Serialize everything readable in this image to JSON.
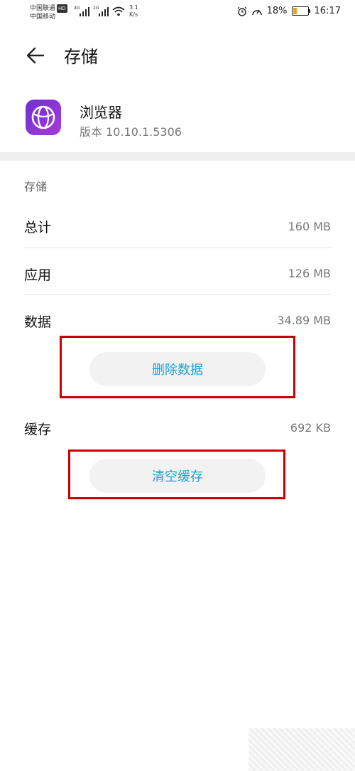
{
  "status_bar": {
    "carrier1": "中国联通",
    "hd": "HD",
    "carrier2": "中国移动",
    "net_top": "4G",
    "net_top2": "2G",
    "speed_value": "3.1",
    "speed_unit": "K/s",
    "battery": "18%",
    "time": "16:17"
  },
  "header": {
    "title": "存储"
  },
  "app": {
    "name": "浏览器",
    "version": "版本 10.10.1.5306"
  },
  "section": {
    "label": "存储"
  },
  "rows": [
    {
      "label": "总计",
      "value": "160 MB"
    },
    {
      "label": "应用",
      "value": "126 MB"
    },
    {
      "label": "数据",
      "value": "34.89 MB"
    },
    {
      "label": "缓存",
      "value": "692 KB"
    }
  ],
  "buttons": {
    "delete_data": "删除数据",
    "clear_cache": "清空缓存"
  },
  "colors": {
    "accent": "#1aa3d6",
    "highlight": "#c80000",
    "app_icon": "#8a35d6"
  }
}
